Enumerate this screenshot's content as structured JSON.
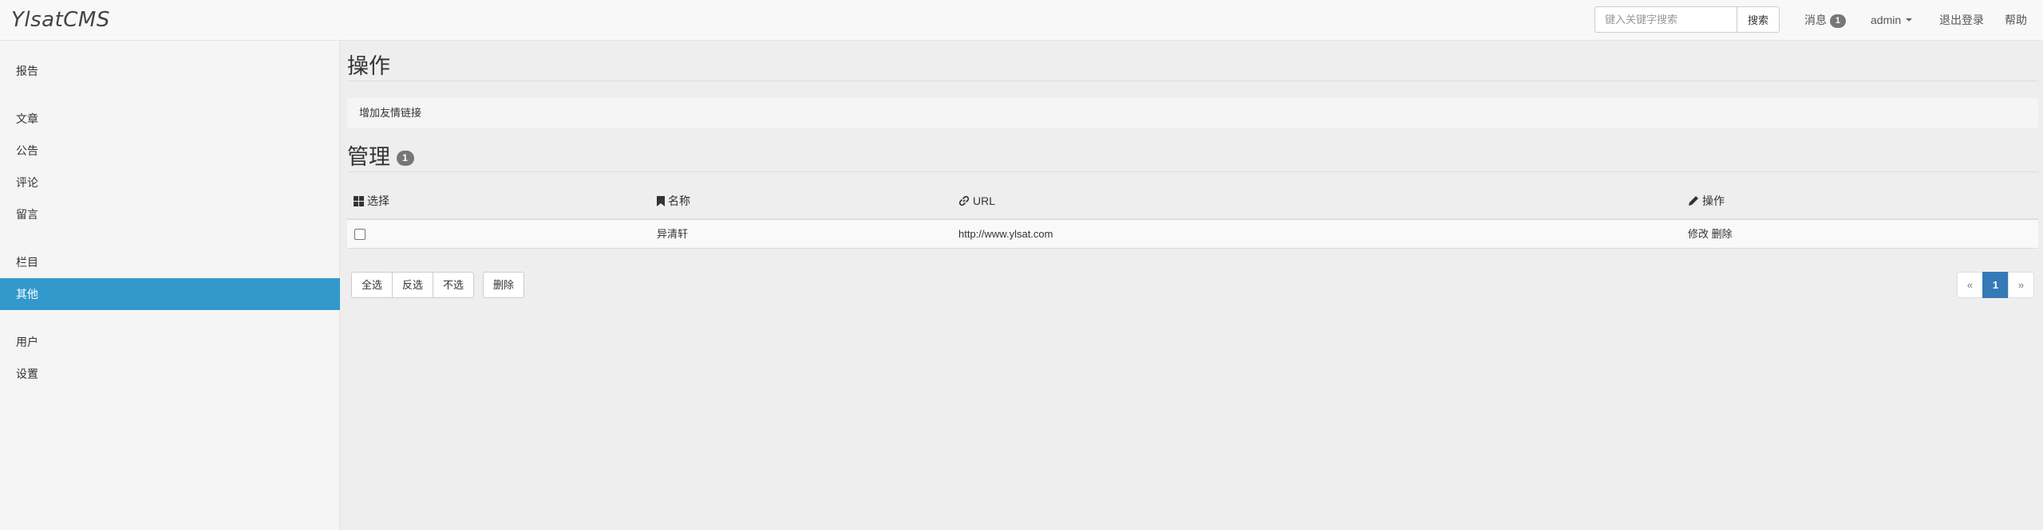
{
  "app": {
    "brand": "YlsatCMS"
  },
  "header": {
    "search_placeholder": "键入关键字搜索",
    "search_button": "搜索",
    "messages_label": "消息",
    "messages_count": "1",
    "user_label": "admin",
    "logout_label": "退出登录",
    "help_label": "帮助"
  },
  "sidebar": {
    "items": [
      {
        "label": "报告"
      },
      {
        "label": "文章"
      },
      {
        "label": "公告"
      },
      {
        "label": "评论"
      },
      {
        "label": "留言"
      },
      {
        "label": "栏目"
      },
      {
        "label": "其他",
        "active": true
      },
      {
        "label": "用户"
      },
      {
        "label": "设置"
      }
    ]
  },
  "main": {
    "ops_title": "操作",
    "add_link_label": "增加友情链接",
    "manage_title": "管理",
    "manage_count": "1",
    "table": {
      "headers": {
        "select": "选择",
        "name": "名称",
        "url": "URL",
        "ops": "操作"
      },
      "rows": [
        {
          "name": "异清轩",
          "url": "http://www.ylsat.com",
          "edit": "修改",
          "delete": "删除"
        }
      ]
    },
    "actions": {
      "select_all": "全选",
      "invert": "反选",
      "select_none": "不选",
      "delete": "删除"
    },
    "pagination": {
      "prev": "«",
      "current": "1",
      "next": "»"
    }
  },
  "colors": {
    "active_nav": "#3399cc",
    "page_active": "#337ab7",
    "badge": "#777777"
  }
}
